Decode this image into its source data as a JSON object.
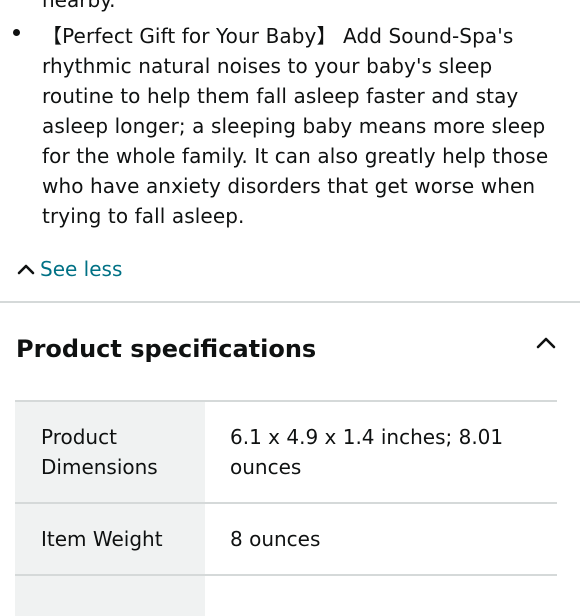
{
  "bullets": {
    "previous_tail": "nearby.",
    "current": "【Perfect Gift for Your Baby】 Add Sound-Spa's rhythmic natural noises to your baby's sleep routine to help them fall asleep faster and stay asleep longer; a sleeping baby means more sleep for the whole family. It can also greatly help those who have anxiety disorders that get worse when trying to fall asleep."
  },
  "see_less": {
    "label": "See less",
    "icon": "chevron-up-icon"
  },
  "specs": {
    "title": "Product specifications",
    "toggle_icon": "chevron-up-icon",
    "rows": [
      {
        "key": "Product Dimensions",
        "value": "6.1 x 4.9 x 1.4 inches; 8.01 ounces"
      },
      {
        "key": "Item Weight",
        "value": "8 ounces"
      },
      {
        "key": "",
        "value": ""
      }
    ]
  },
  "colors": {
    "link": "#007185",
    "text": "#0f1111",
    "divider": "#d5d9d9",
    "key_bg": "#f0f2f2"
  }
}
